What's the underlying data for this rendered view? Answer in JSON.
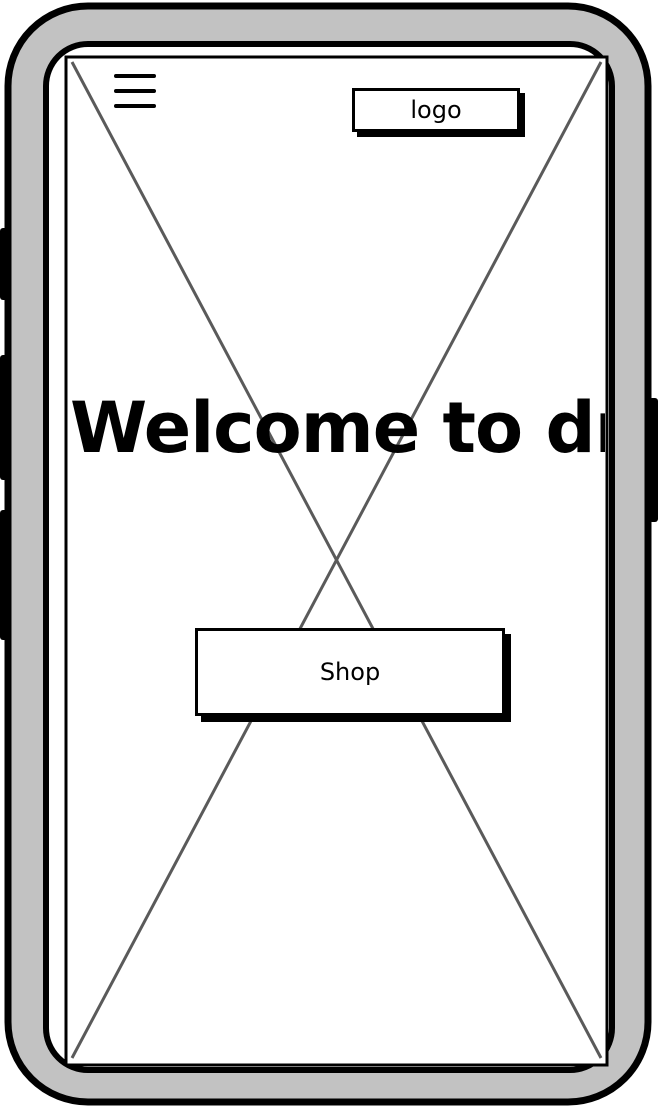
{
  "header": {
    "menu_icon": "hamburger-menu-icon",
    "logo_text": "logo"
  },
  "hero": {
    "headline": "Welcome to dr",
    "image_placeholder": "x-placeholder-image"
  },
  "actions": {
    "shop_label": "Shop"
  },
  "colors": {
    "device_body": "#c2c2c2",
    "outline": "#000000",
    "screen": "#ffffff",
    "placeholder_lines": "#5a5a5a"
  }
}
